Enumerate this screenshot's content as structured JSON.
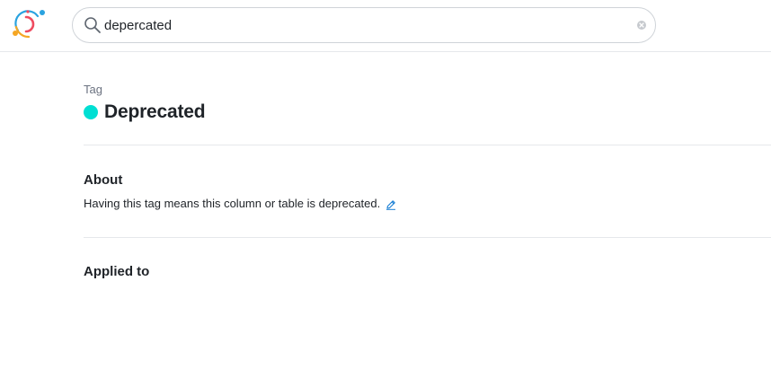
{
  "search": {
    "value": "depercated",
    "placeholder": ""
  },
  "entity": {
    "kind_label": "Tag",
    "name": "Deprecated",
    "color": "#00dfd3"
  },
  "about": {
    "heading": "About",
    "description": "Having this tag means this column or table is deprecated."
  },
  "applied_to": {
    "heading": "Applied to"
  },
  "icons": {
    "logo": "app-logo",
    "search": "search-icon",
    "clear": "clear-icon",
    "edit": "pencil-icon"
  },
  "colors": {
    "accent": "#1a7fd4",
    "logo_blue": "#2aa3e0",
    "logo_red": "#ef4b5f",
    "logo_orange": "#f5a623"
  }
}
